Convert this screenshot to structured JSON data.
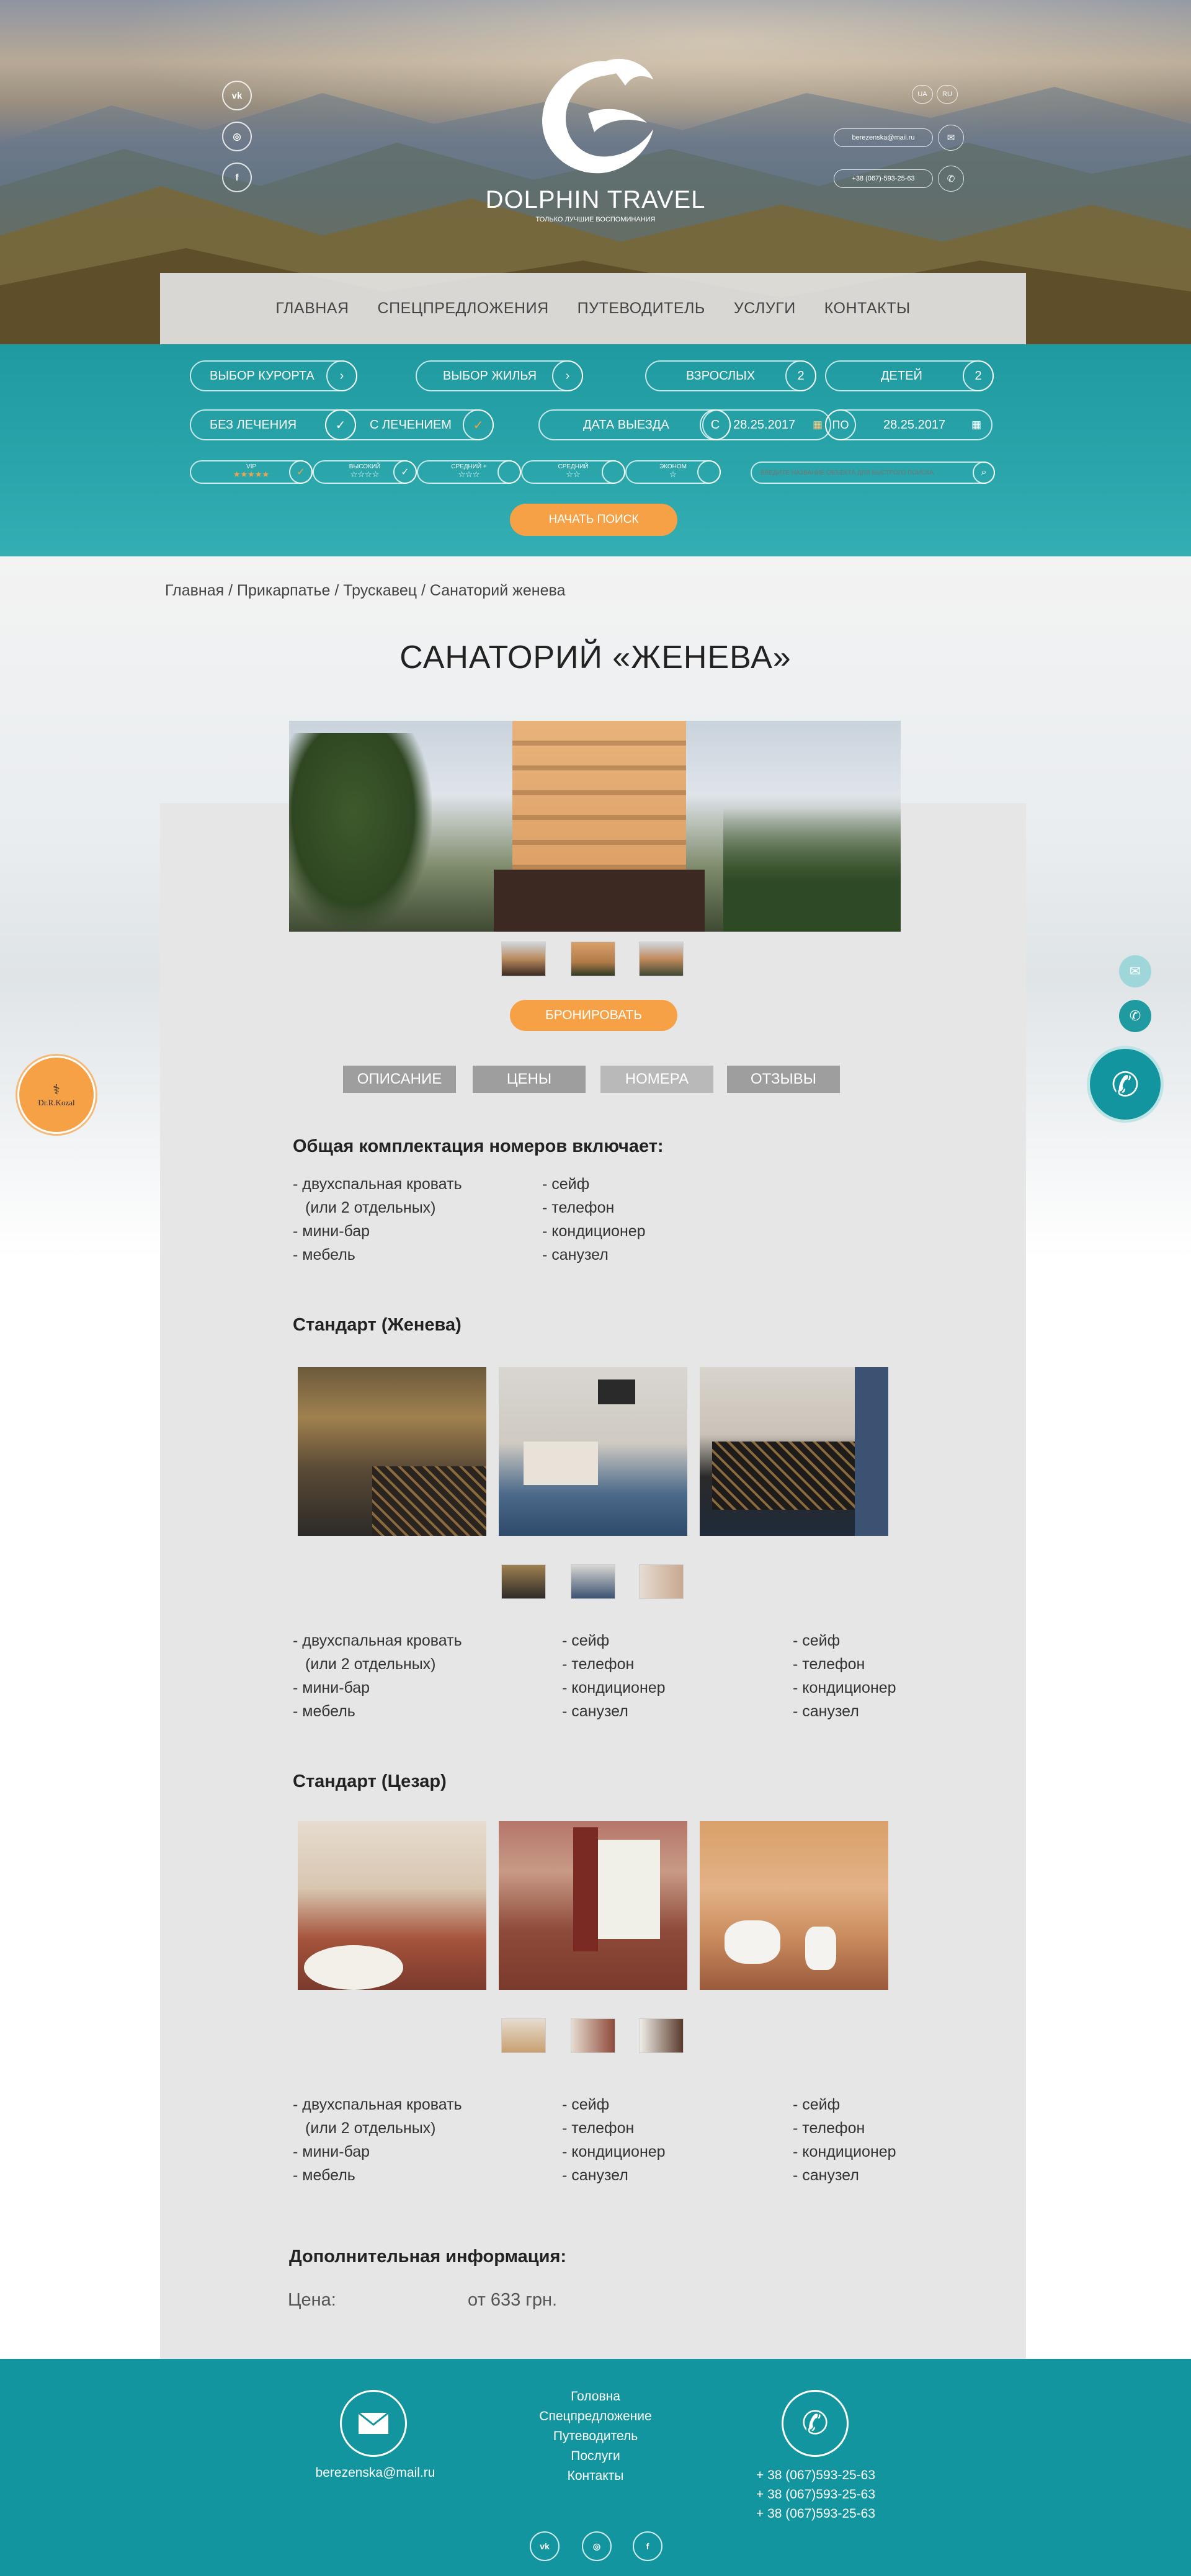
{
  "header": {
    "brand": "DOLPHIN TRAVEL",
    "tagline": "ТОЛЬКО ЛУЧШИЕ ВОСПОМИНАНИЯ",
    "social": [
      "vk",
      "instagram",
      "facebook"
    ],
    "lang": [
      "UA",
      "RU"
    ],
    "email": "berezenska@mail.ru",
    "phone": "+38 (067)-593-25-63"
  },
  "nav": {
    "items": [
      "ГЛАВНАЯ",
      "СПЕЦПРЕДЛОЖЕНИЯ",
      "ПУТЕВОДИТЕЛЬ",
      "УСЛУГИ",
      "КОНТАКТЫ"
    ]
  },
  "filter": {
    "resort": "ВЫБОР КУРОРТА",
    "housing": "ВЫБОР ЖИЛЬЯ",
    "adults_label": "ВЗРОСЛЫХ",
    "adults_value": "2",
    "children_label": "ДЕТЕЙ",
    "children_value": "2",
    "no_treatment": "БЕЗ ЛЕЧЕНИЯ",
    "with_treatment": "С ЛЕЧЕНИЕМ",
    "departure_label": "ДАТА ВЫЕЗДА",
    "from_label": "С",
    "from_date": "28.25.2017",
    "to_label": "ПО",
    "to_date": "28.25.2017",
    "ratings": [
      {
        "label": "VIP",
        "stars": "★★★★★"
      },
      {
        "label": "ВЫСОКИЙ",
        "stars": "☆☆☆☆"
      },
      {
        "label": "СРЕДНИЙ +",
        "stars": "☆☆☆"
      },
      {
        "label": "СРЕДНИЙ",
        "stars": "☆☆"
      },
      {
        "label": "ЭКОНОМ",
        "stars": "☆"
      }
    ],
    "search_placeholder": "ВВЕДИТЕ НАЗВАНИЕ ОБЪЕКТА ДЛЯ БЫСТРОГО ПОИСКА",
    "search_button": "НАЧАТЬ ПОИСК"
  },
  "breadcrumb": "Главная / Прикарпатье / Трускавец / Санаторий женева",
  "title": "САНАТОРИЙ «ЖЕНЕВА»",
  "book_button": "БРОНИРОВАТЬ",
  "tabs": [
    "ОПИСАНИЕ",
    "ЦЕНЫ",
    "НОМЕРА",
    "ОТЗЫВЫ"
  ],
  "general": {
    "heading": "Общая комплектация номеров включает:",
    "col1": [
      "- двухспальная кровать",
      "  (или 2 отдельных)",
      "- мини-бар",
      "- мебель"
    ],
    "col2": [
      "- сейф",
      "- телефон",
      "- кондиционер",
      "- санузел"
    ]
  },
  "rooms": [
    {
      "heading": "Стандарт (Женева)",
      "col1": [
        "- двухспальная кровать",
        "  (или 2 отдельных)",
        "- мини-бар",
        "- мебель"
      ],
      "col2": [
        "- сейф",
        "- телефон",
        "- кондиционер",
        "- санузел"
      ],
      "col3": [
        "- сейф",
        "- телефон",
        "- кондиционер",
        "- санузел"
      ]
    },
    {
      "heading": "Стандарт (Цезар)",
      "col1": [
        "- двухспальная кровать",
        "  (или 2 отдельных)",
        "- мини-бар",
        "- мебель"
      ],
      "col2": [
        "- сейф",
        "- телефон",
        "- кондиционер",
        "- санузел"
      ],
      "col3": [
        "- сейф",
        "- телефон",
        "- кондиционер",
        "- санузел"
      ]
    }
  ],
  "additional": {
    "heading": "Дополнительная информация:",
    "price_label": "Цена:",
    "price_value": "от 633 грн."
  },
  "partner_badge": "Dr.R.Kozal",
  "footer": {
    "email": "berezenska@mail.ru",
    "links": [
      "Головна",
      "Спецпредложение",
      "Путеводитель",
      "Послуги",
      "Контакты"
    ],
    "phones": [
      "+ 38 (067)593-25-63",
      "+ 38 (067)593-25-63",
      "+ 38 (067)593-25-63"
    ],
    "social": [
      "vk",
      "instagram",
      "facebook"
    ]
  },
  "colors": {
    "teal": "#1e9aa0",
    "orange": "#f7a146",
    "panel": "#e6e6e6",
    "footer": "#12959f"
  }
}
